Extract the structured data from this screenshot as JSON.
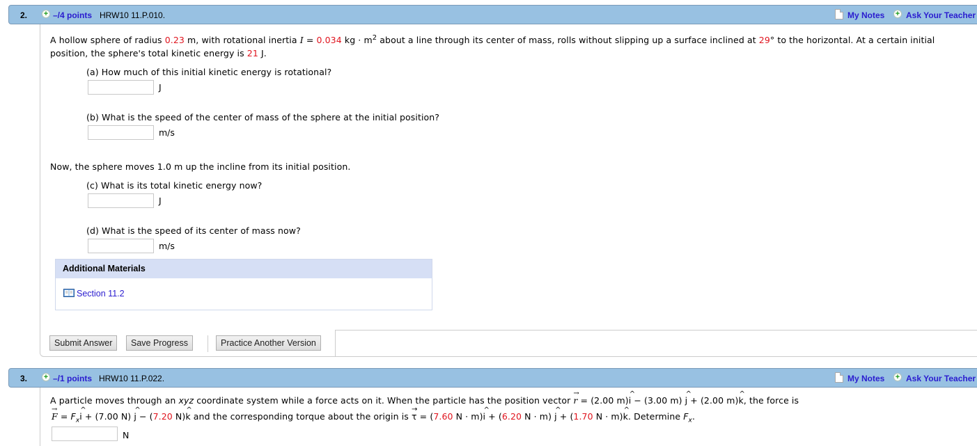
{
  "questions": [
    {
      "number": "2.",
      "points": "–/4 points",
      "code": "HRW10 11.P.010.",
      "my_notes": "My Notes",
      "ask_teacher": "Ask Your Teacher",
      "problem": {
        "t1": "A hollow sphere of radius ",
        "radius": "0.23",
        "t2": " m, with rotational inertia ",
        "I_sym": "I",
        "t3": " = ",
        "inertia": "0.034",
        "t4": " kg · m",
        "sup": "2",
        "t5": " about a line through its center of mass, rolls without slipping up a surface inclined at ",
        "angle": "29",
        "t6": "° to the horizontal. At a certain initial",
        "line2_a": "position, the sphere's total kinetic energy is ",
        "energy": "21",
        "line2_b": " J."
      },
      "parts": [
        {
          "label": "(a) How much of this initial kinetic energy is rotational?",
          "value": "",
          "unit": "J"
        },
        {
          "label": "(b) What is the speed of the center of mass of the sphere at the initial position?",
          "value": "",
          "unit": "m/s"
        },
        {
          "label": "(c) What is its total kinetic energy now?",
          "value": "",
          "unit": "J"
        },
        {
          "label": "(d) What is the speed of its center of mass now?",
          "value": "",
          "unit": "m/s"
        }
      ],
      "interlude": "Now, the sphere moves 1.0 m up the incline from its initial position.",
      "additional_materials": {
        "title": "Additional Materials",
        "link": "Section 11.2"
      },
      "buttons": {
        "submit": "Submit Answer",
        "save": "Save Progress",
        "practice": "Practice Another Version"
      }
    },
    {
      "number": "3.",
      "points": "–/1 points",
      "code": "HRW10 11.P.022.",
      "my_notes": "My Notes",
      "ask_teacher": "Ask Your Teacher",
      "problem": {
        "l1_a": "A particle moves through an ",
        "xyz": "xyz",
        "l1_b": " coordinate system while a force acts on it. When the particle has the position vector ",
        "r": "r",
        "l1_c": " = (2.00 m)",
        "l1_d": " − (3.00 m) ",
        "l1_e": " + (2.00 m)",
        "l1_f": ",  the force is",
        "F": "F",
        "l2_a": " = ",
        "Fx": "F",
        "x": "x",
        "l2_b": " + (7.00 N) ",
        "l2_c": " − (",
        "fz": "7.20",
        "l2_d": " N)",
        "l2_e": "  and the corresponding torque about the origin is ",
        "tau": "τ",
        "l2_f": " = (",
        "tx": "7.60",
        "l2_g": " N · m)",
        "l2_h": " + (",
        "ty": "6.20",
        "l2_i": " N · m) ",
        "l2_j": " + (",
        "tz": "1.70",
        "l2_k": " N · m)",
        "l2_l": ".  Determine ",
        "det_F": "F",
        "det_x": "x",
        "l2_m": ".",
        "i": "i",
        "j": "j",
        "k": "k",
        "hat": "^",
        "arrow": "→"
      },
      "answer": {
        "value": "",
        "unit": "N"
      }
    }
  ],
  "icons": {
    "plus": "+"
  }
}
